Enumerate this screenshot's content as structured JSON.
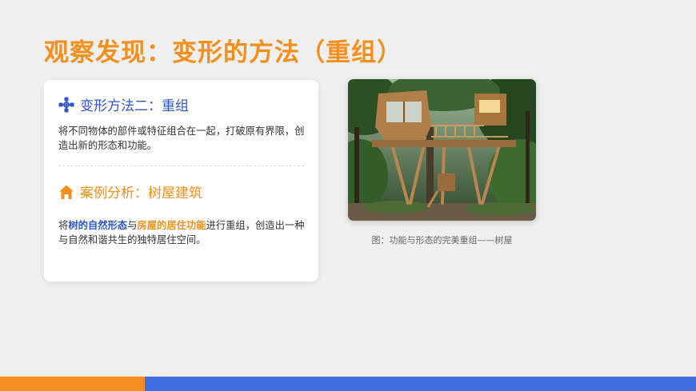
{
  "slide": {
    "title": "观察发现：变形的方法（重组）"
  },
  "card": {
    "section1": {
      "icon": "hub-network-icon",
      "heading": "变形方法二：重组",
      "text": "将不同物体的部件或特征组合在一起，打破原有界限，创造出新的形态和功能。"
    },
    "section2": {
      "icon": "house-icon",
      "heading": "案例分析：树屋建筑",
      "text_prefix": "将",
      "highlight1": "树的自然形态",
      "text_mid1": "与",
      "highlight2": "房屋的居住功能",
      "text_suffix": "进行重组，创造出一种与自然和谐共生的独特居住空间。"
    }
  },
  "figure": {
    "image": "treehouse-photo",
    "caption": "图：功能与形态的完美重组——树屋"
  },
  "colors": {
    "accent_orange": "#f38f1c",
    "accent_blue": "#2f56c7",
    "bar_blue": "#3e6fe0",
    "background": "#efefef"
  }
}
